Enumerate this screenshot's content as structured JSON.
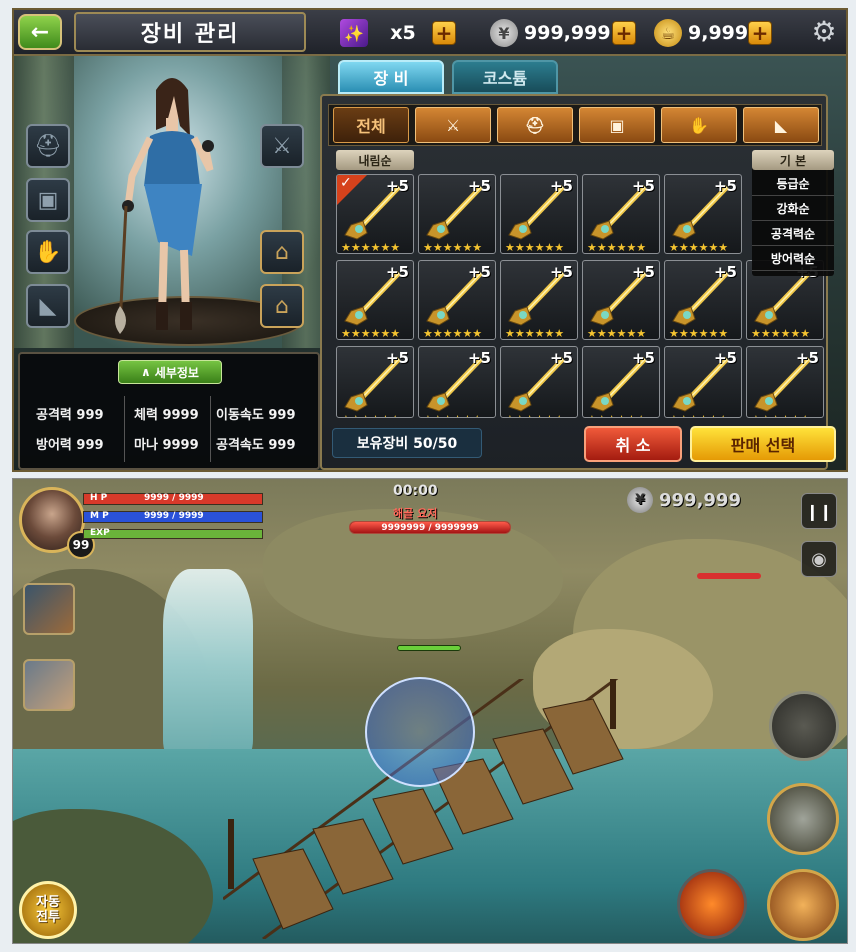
{
  "equipment": {
    "title": "장비 관리",
    "back_icon": "arrow-left-icon",
    "currency": {
      "gem": {
        "icon": "purple-gem-icon",
        "value": "x5"
      },
      "silver": {
        "icon": "silver-coin-icon",
        "value": "999,999"
      },
      "gold": {
        "icon": "gold-lamp-icon",
        "value": "9,999"
      }
    },
    "settings_icon": "gear-icon",
    "tabs": [
      {
        "label": "장 비",
        "active": true
      },
      {
        "label": "코스튬",
        "active": false
      }
    ],
    "categories": [
      {
        "label": "전체",
        "icon": "",
        "selected": true
      },
      {
        "label": "",
        "icon": "sword-icon",
        "selected": false
      },
      {
        "label": "",
        "icon": "helmet-icon",
        "selected": false
      },
      {
        "label": "",
        "icon": "armor-icon",
        "selected": false
      },
      {
        "label": "",
        "icon": "glove-icon",
        "selected": false
      },
      {
        "label": "",
        "icon": "boot-icon",
        "selected": false
      }
    ],
    "sort_order_label": "내림순",
    "sort_menu": {
      "header": "기 본",
      "options": [
        "등급순",
        "강화순",
        "공격력순",
        "방어력순"
      ]
    },
    "item_level": "+5",
    "item_count": 15,
    "owned_label": "보유장비 50/50",
    "cancel_label": "취 소",
    "sell_label": "판매 선택",
    "detail_label": "세부정보",
    "stats": [
      {
        "label": "공격력 999"
      },
      {
        "label": "체력 9999"
      },
      {
        "label": "이동속도 999"
      },
      {
        "label": "방어력 999"
      },
      {
        "label": "마나 9999"
      },
      {
        "label": "공격속도 999"
      }
    ],
    "equip_slots_left": [
      "helmet-slot-icon",
      "armor-slot-icon",
      "glove-slot-icon",
      "boot-slot-icon"
    ],
    "equip_slots_right": [
      "sword-slot-icon",
      "hanger-slot-icon",
      "hanger-slot-icon"
    ]
  },
  "battle": {
    "level": "99",
    "hp": {
      "label": "H P",
      "value": "9999 / 9999",
      "color": "#d83a2a"
    },
    "mp": {
      "label": "M P",
      "value": "9999 / 9999",
      "color": "#2a52d8"
    },
    "exp": {
      "label": "EXP",
      "color": "#6ab43a"
    },
    "timer": "00:00",
    "boss_name": "해골 요저",
    "boss_hp": "9999999 / 9999999",
    "silver": "999,999",
    "pause_icon": "pause-icon",
    "camera_icon": "camera-icon",
    "auto_label_1": "자동",
    "auto_label_2": "전투"
  }
}
